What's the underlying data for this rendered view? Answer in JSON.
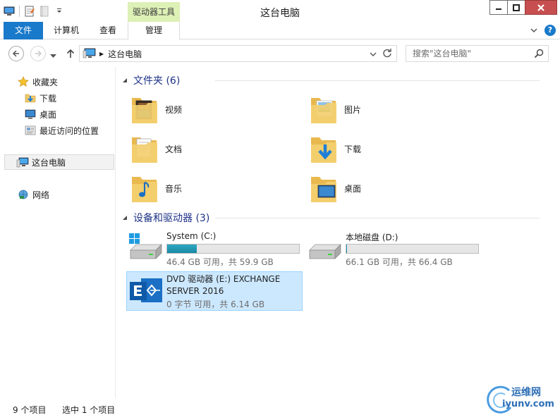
{
  "window": {
    "title": "这台电脑",
    "contextual_tab_group": "驱动器工具"
  },
  "ribbon": {
    "tabs": [
      {
        "label": "文件"
      },
      {
        "label": "计算机"
      },
      {
        "label": "查看"
      },
      {
        "label": "管理"
      }
    ]
  },
  "address_bar": {
    "path": "这台电脑"
  },
  "search": {
    "placeholder": "搜索\"这台电脑\""
  },
  "sidebar": {
    "favorites": {
      "label": "收藏夹"
    },
    "favorite_items": [
      {
        "label": "下载"
      },
      {
        "label": "桌面"
      },
      {
        "label": "最近访问的位置"
      }
    ],
    "this_pc": {
      "label": "这台电脑"
    },
    "network": {
      "label": "网络"
    }
  },
  "folders_group": {
    "title": "文件夹 (6)",
    "items": [
      {
        "label": "视频",
        "icon": "videos-folder-icon"
      },
      {
        "label": "图片",
        "icon": "pictures-folder-icon"
      },
      {
        "label": "文档",
        "icon": "documents-folder-icon"
      },
      {
        "label": "下载",
        "icon": "downloads-folder-icon"
      },
      {
        "label": "音乐",
        "icon": "music-folder-icon"
      },
      {
        "label": "桌面",
        "icon": "desktop-folder-icon"
      }
    ]
  },
  "drives_group": {
    "title": "设备和驱动器 (3)",
    "items": [
      {
        "name": "System (C:)",
        "size_text": "46.4 GB 可用，共 59.9 GB",
        "used_fraction": 0.225,
        "icon": "windows-drive-icon"
      },
      {
        "name": "本地磁盘 (D:)",
        "size_text": "66.1 GB 可用，共 66.4 GB",
        "used_fraction": 0.005,
        "icon": "local-disk-icon"
      },
      {
        "name": "DVD 驱动器 (E:) EXCHANGE SERVER 2016",
        "size_text": "0 字节 可用，共 6.14 GB",
        "icon": "exchange-dvd-icon"
      }
    ]
  },
  "status_bar": {
    "item_count": "9 个项目",
    "selection": "选中 1 个项目"
  },
  "watermark": {
    "cn": "运维网",
    "en": "iyunv.com"
  },
  "colors": {
    "accent": "#1979ca",
    "group_header": "#1e3287",
    "selection_bg": "#cce8ff",
    "drive_bar_fill": "#1a8aa5",
    "contextual_tab": "#ddf0b6"
  }
}
